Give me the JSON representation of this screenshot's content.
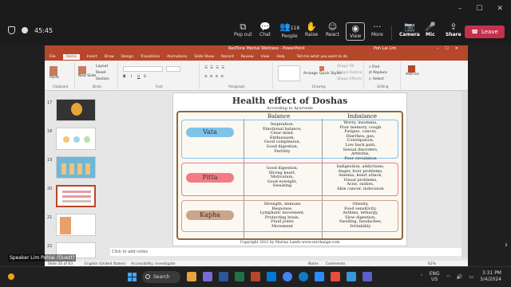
{
  "teams": {
    "call_time": "45:45",
    "buttons": [
      {
        "label": "Pop out",
        "icon": "pop-out-icon"
      },
      {
        "label": "Chat",
        "icon": "chat-icon"
      },
      {
        "label": "People",
        "icon": "people-icon",
        "count": "118"
      },
      {
        "label": "Raise",
        "icon": "raise-hand-icon"
      },
      {
        "label": "React",
        "icon": "react-icon"
      },
      {
        "label": "View",
        "icon": "view-icon"
      },
      {
        "label": "More",
        "icon": "more-icon"
      },
      {
        "label": "Camera",
        "icon": "camera-off-icon"
      },
      {
        "label": "Mic",
        "icon": "mic-off-icon"
      },
      {
        "label": "Share",
        "icon": "share-icon"
      }
    ],
    "leave_label": "Leave",
    "speaker": "Speaker Lim Pohlai (Guest)",
    "colors": {
      "leave": "#c4314b",
      "bar": "#1b1b1b"
    }
  },
  "ppt": {
    "window_title": "RedTone Mental Wellness - PowerPoint",
    "user": "Poh Lai Lim",
    "tabs": [
      "File",
      "Home",
      "Insert",
      "Draw",
      "Design",
      "Transitions",
      "Animations",
      "Slide Show",
      "Record",
      "Review",
      "View",
      "Help"
    ],
    "active_tab": "Home",
    "tell_me": "Tell me what you want to do",
    "ribbon": {
      "paste": "Paste",
      "new_slide": "New Slide",
      "layout": "Layout",
      "reset": "Reset",
      "section": "Section",
      "groups": [
        "Clipboard",
        "Slides",
        "Font",
        "Paragraph",
        "Drawing",
        "Editing"
      ],
      "arrange": "Arrange",
      "quick_styles": "Quick Styles",
      "shape_fill": "Shape Fill",
      "shape_outline": "Shape Outline",
      "shape_effects": "Shape Effects",
      "find": "Find",
      "replace": "Replace",
      "select": "Select",
      "addins": "Add-ins"
    },
    "thumbnails": [
      "17",
      "18",
      "19",
      "20",
      "21",
      "22"
    ],
    "selected_thumbnail": "20",
    "notes_placeholder": "Click to add notes",
    "status": {
      "slide": "Slide 20 of 63",
      "language": "English (United States)",
      "accessibility": "Accessibility: Investigate",
      "notes": "Notes",
      "comments": "Comments",
      "zoom": "62%"
    },
    "colors": {
      "accent": "#b7472a"
    }
  },
  "slide": {
    "title": "Health effect of Doshas",
    "subtitle": "According to Ayurveda",
    "col_balance": "Balance",
    "col_imbalance": "Imbalance",
    "rows": [
      {
        "name": "Vata",
        "color": "#7fc3ea",
        "balance": [
          "Inspiration,",
          "Emotional balance,",
          "Clear mind,",
          "Enthusiasm,",
          "Good complexion,",
          "Good digestion,",
          "Fertility"
        ],
        "imbalance": [
          "Worry, insomnia,",
          "Poor memory, cough",
          "Fatigue, cancer,",
          "Diarrhea, gas,",
          "Constipation,",
          "Low back pain,",
          "Sexual disorders,",
          "Arthritis,",
          "Poor circulation"
        ]
      },
      {
        "name": "Pitta",
        "color": "#f47b82",
        "balance": [
          "Good digestion,",
          "Strong heart,",
          "Motivation,",
          "Good eyesight,",
          "Sweating"
        ],
        "imbalance": [
          "Indigestion, addictions,",
          "Anger, liver problems,",
          "Anemia, heart attack,",
          "Visual problems,",
          "Acne, rashes,",
          "Skin cancer, indecision"
        ]
      },
      {
        "name": "Kapha",
        "color": "#c9a58a",
        "balance": [
          "Strength, immune",
          "Response,",
          "Lymphatic movement,",
          "Protecting brain,",
          "Fluid joints",
          "Movement"
        ],
        "imbalance": [
          "Obesity,",
          "Food sensitivity,",
          "Asthma, lethargy,",
          "Slow digestion,",
          "Swelling, headaches,",
          "Irritability"
        ]
      }
    ],
    "copyright": "Copyright 2012 by Marina Lando www.surchange.com"
  },
  "taskbar": {
    "search": "Search",
    "lang": "ENG",
    "region": "US",
    "time": "3:31 PM",
    "date": "3/4/2024"
  }
}
